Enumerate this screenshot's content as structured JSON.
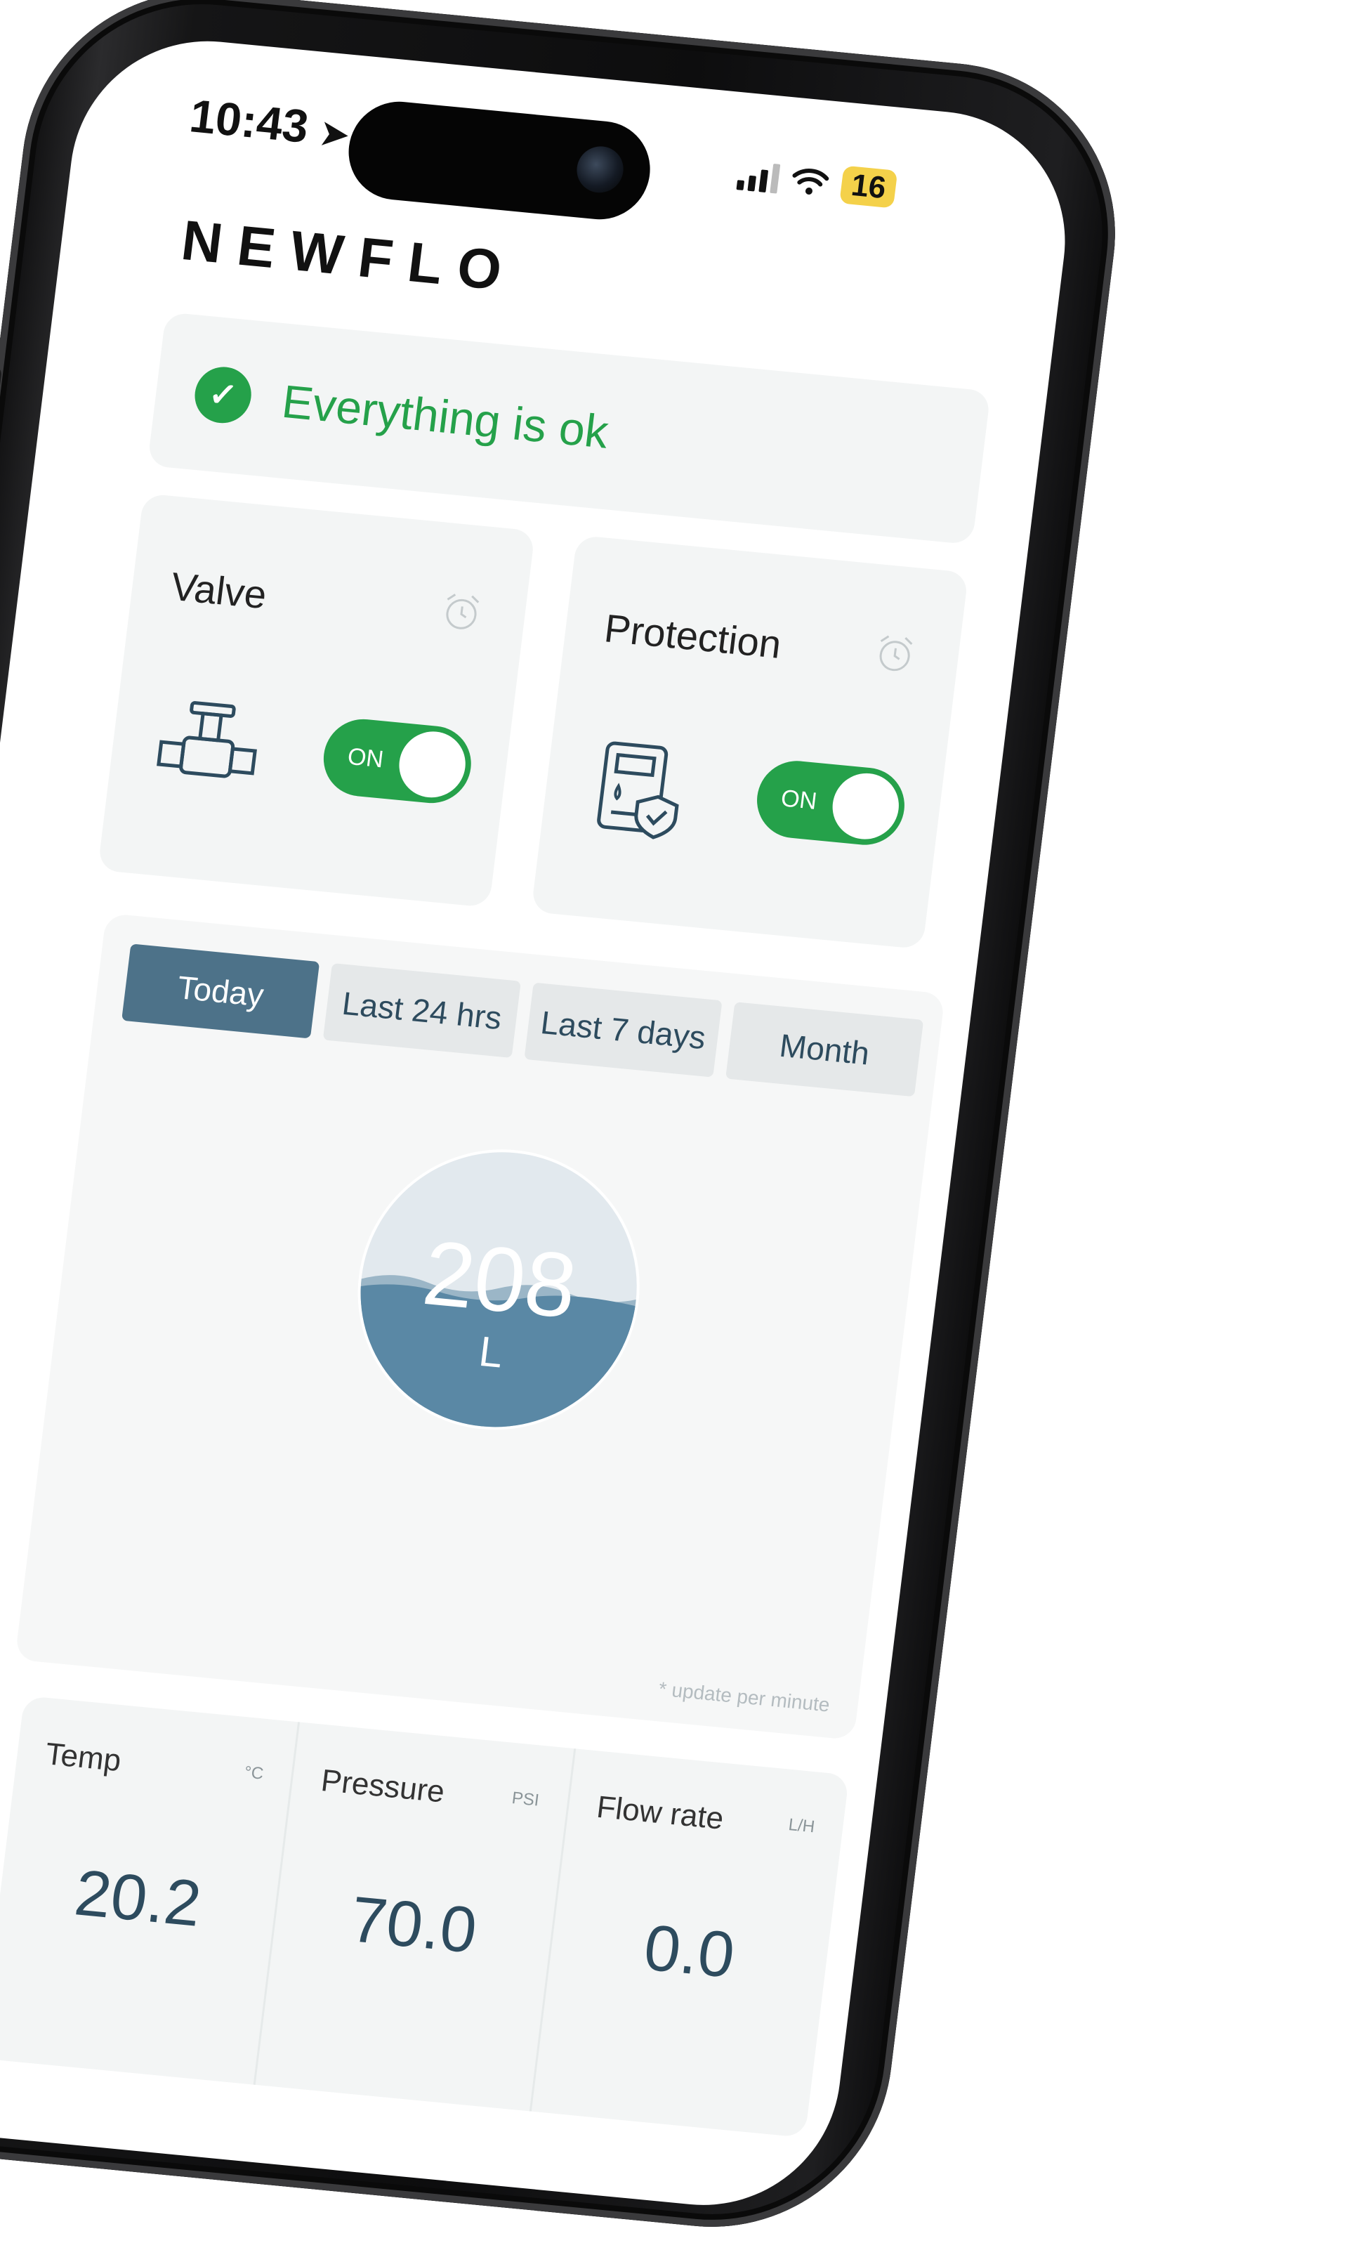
{
  "status_bar": {
    "time": "10:43",
    "battery": "16"
  },
  "brand": "NEWFLO",
  "status": {
    "text": "Everything is ok"
  },
  "controls": [
    {
      "label": "Valve",
      "toggle": "ON",
      "on": true
    },
    {
      "label": "Protection",
      "toggle": "ON",
      "on": true
    }
  ],
  "tabs": [
    "Today",
    "Last 24 hrs",
    "Last 7 days",
    "Month"
  ],
  "active_tab": "Today",
  "usage": {
    "value": "208",
    "unit": "L",
    "note": "* update per minute"
  },
  "metrics": [
    {
      "label": "Temp",
      "unit": "°C",
      "value": "20.2"
    },
    {
      "label": "Pressure",
      "unit": "PSI",
      "value": "70.0"
    },
    {
      "label": "Flow rate",
      "unit": "L/H",
      "value": "0.0"
    }
  ],
  "colors": {
    "accent_green": "#25a14a",
    "tab_active": "#4d7289",
    "water": "#5a88a5",
    "text_dark": "#2d4b5e"
  }
}
